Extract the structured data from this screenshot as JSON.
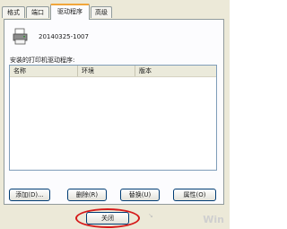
{
  "tabs": [
    {
      "label": "格式"
    },
    {
      "label": "端口"
    },
    {
      "label": "驱动程序"
    },
    {
      "label": "高级"
    }
  ],
  "printer": {
    "name": "20140325-1007"
  },
  "drivers": {
    "label": "安装的打印机驱动程序:",
    "columns": [
      "名称",
      "环境",
      "版本"
    ]
  },
  "buttons": {
    "add": "添加(D)...",
    "remove": "删除(R)",
    "update": "替换(U)",
    "properties": "属性(O)",
    "close": "关闭"
  },
  "footer": {
    "faded_text": "↘"
  },
  "colors": {
    "highlight_circle": "#d51a1a",
    "active_tab_accent": "#f1a63a"
  },
  "watermark": "Win"
}
